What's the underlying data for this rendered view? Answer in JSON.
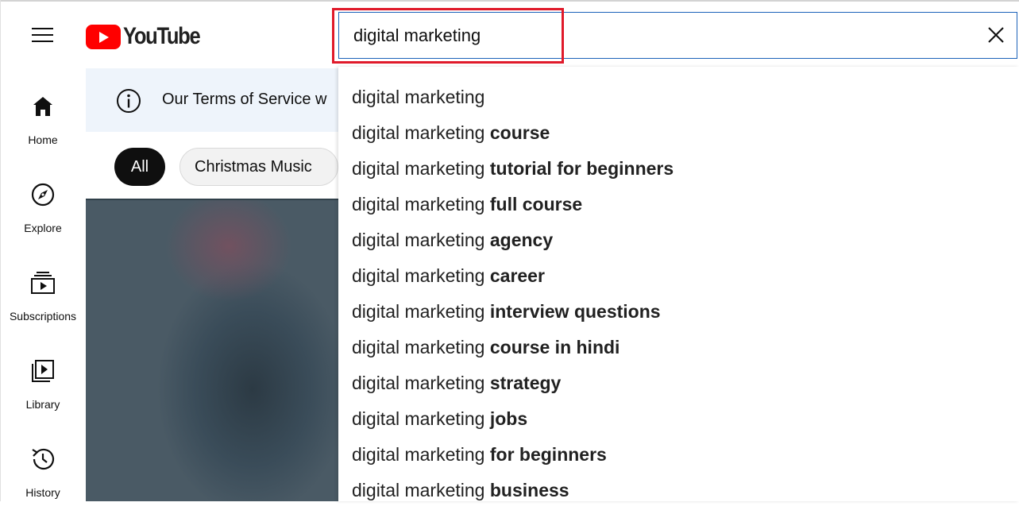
{
  "header": {
    "logo_text": "YouTube",
    "search_value": "digital marketing"
  },
  "sidebar": {
    "items": [
      {
        "label": "Home",
        "icon": "home-icon"
      },
      {
        "label": "Explore",
        "icon": "compass-icon"
      },
      {
        "label": "Subscriptions",
        "icon": "subscriptions-icon"
      },
      {
        "label": "Library",
        "icon": "library-icon"
      },
      {
        "label": "History",
        "icon": "history-icon"
      }
    ]
  },
  "banner": {
    "text": "Our Terms of Service w"
  },
  "chips": [
    {
      "label": "All",
      "selected": true
    },
    {
      "label": "Christmas Music",
      "selected": false
    }
  ],
  "suggestions": [
    {
      "prefix": "digital marketing",
      "suffix": ""
    },
    {
      "prefix": "digital marketing ",
      "suffix": "course"
    },
    {
      "prefix": "digital marketing ",
      "suffix": "tutorial for beginners"
    },
    {
      "prefix": "digital marketing ",
      "suffix": "full course"
    },
    {
      "prefix": "digital marketing ",
      "suffix": "agency"
    },
    {
      "prefix": "digital marketing ",
      "suffix": "career"
    },
    {
      "prefix": "digital marketing ",
      "suffix": "interview questions"
    },
    {
      "prefix": "digital marketing ",
      "suffix": "course in hindi"
    },
    {
      "prefix": "digital marketing ",
      "suffix": "strategy"
    },
    {
      "prefix": "digital marketing ",
      "suffix": "jobs"
    },
    {
      "prefix": "digital marketing ",
      "suffix": "for beginners"
    },
    {
      "prefix": "digital marketing ",
      "suffix": "business"
    }
  ],
  "colors": {
    "brand_red": "#ff0000",
    "highlight_red": "#e01a2a",
    "search_border": "#1c62b9"
  }
}
